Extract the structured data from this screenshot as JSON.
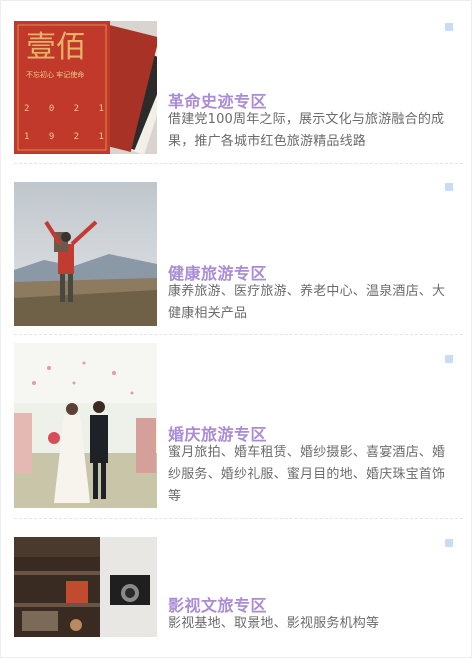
{
  "cards": [
    {
      "title": "革命史迹专区",
      "desc": "借建党100周年之际，展示文化与旅游融合的成果，推广各城市红色旅游精品线路",
      "image": "red-anniversary-books"
    },
    {
      "title": "健康旅游专区",
      "desc": "康养旅游、医疗旅游、养老中心、温泉酒店、大健康相关产品",
      "image": "hiker-mountain"
    },
    {
      "title": "婚庆旅游专区",
      "desc": "蜜月旅拍、婚车租赁、婚纱摄影、喜宴酒店、婚纱服务、婚纱礼服、蜜月目的地、婚庆珠宝首饰等",
      "image": "wedding-couple"
    },
    {
      "title": "影视文旅专区",
      "desc": "影视基地、取景地、影视服务机构等",
      "image": "vintage-cameras"
    }
  ],
  "book_cover": {
    "big_text": "壹佰",
    "slogan": "不忘初心 牢记使命",
    "years": "2021 1921"
  },
  "colors": {
    "title": "#a98bd6",
    "desc": "#6b6b6b",
    "marker": "#c8dcf5",
    "book_red": "#c0392b"
  }
}
